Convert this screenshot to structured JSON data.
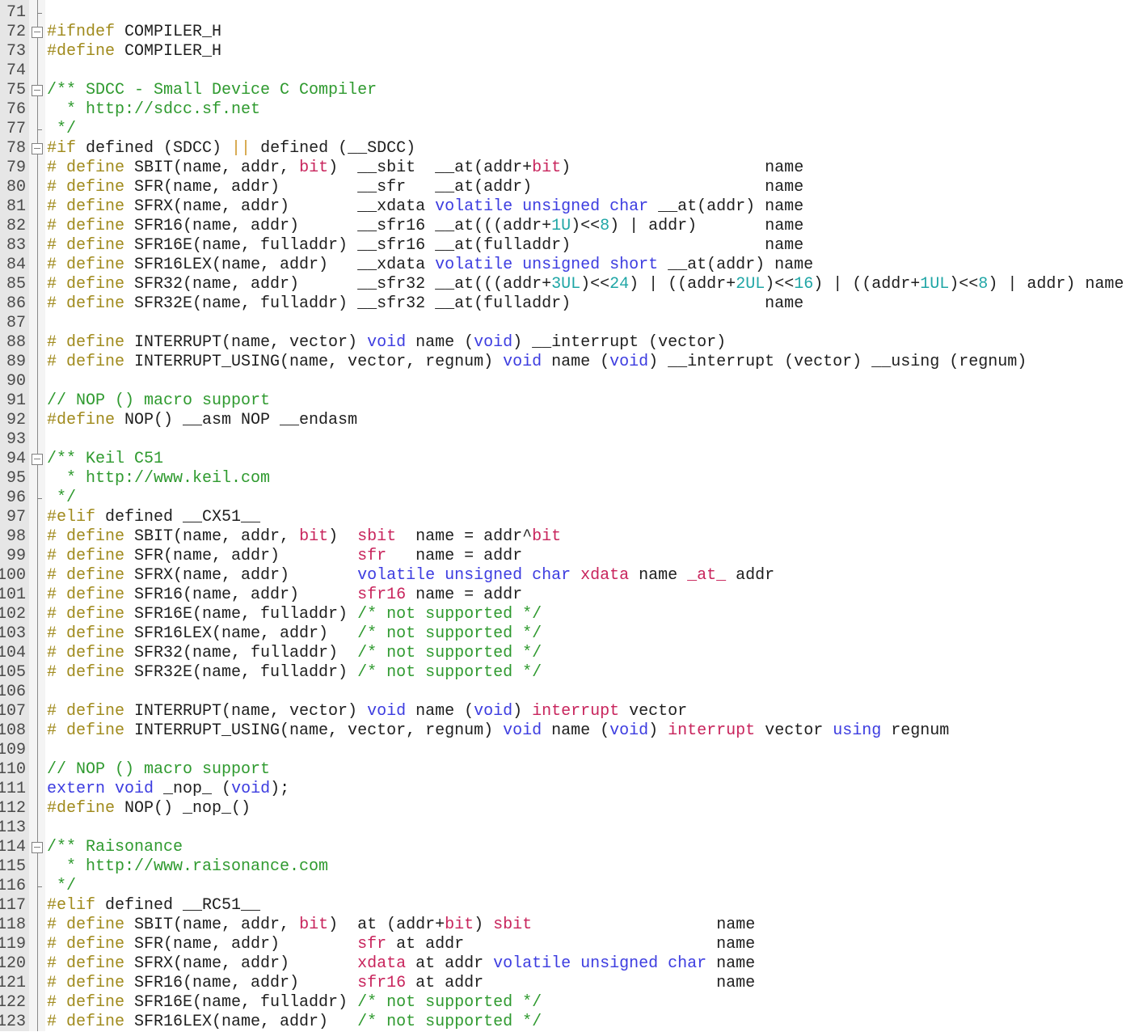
{
  "editor": {
    "colors": {
      "preprocessor": "#a08a1c",
      "comment": "#2f9a2f",
      "keyword": "#3c3ce0",
      "keyword2": "#c8245c",
      "number": "#20a6a6",
      "operator": "#d09a30",
      "text": "#1e1e1e"
    },
    "lines": [
      {
        "n": "71",
        "fold": "end",
        "tok": []
      },
      {
        "n": "72",
        "fold": "open",
        "tok": [
          [
            "pp",
            "#ifndef"
          ],
          [
            "p",
            " COMPILER_H"
          ]
        ]
      },
      {
        "n": "73",
        "fold": "",
        "tok": [
          [
            "pp",
            "#define"
          ],
          [
            "p",
            " COMPILER_H"
          ]
        ]
      },
      {
        "n": "74",
        "fold": "",
        "tok": []
      },
      {
        "n": "75",
        "fold": "open",
        "tok": [
          [
            "c",
            "/** SDCC - Small Device C Compiler"
          ]
        ]
      },
      {
        "n": "76",
        "fold": "",
        "tok": [
          [
            "c",
            "  * http://sdcc.sf.net"
          ]
        ]
      },
      {
        "n": "77",
        "fold": "end",
        "tok": [
          [
            "c",
            " */"
          ]
        ]
      },
      {
        "n": "78",
        "fold": "open",
        "tok": [
          [
            "pp",
            "#if"
          ],
          [
            "p",
            " defined (SDCC) "
          ],
          [
            "o",
            "||"
          ],
          [
            "p",
            " defined (__SDCC)"
          ]
        ]
      },
      {
        "n": "79",
        "fold": "",
        "tok": [
          [
            "pp",
            "# define"
          ],
          [
            "p",
            " SBIT(name, addr, "
          ],
          [
            "r",
            "bit"
          ],
          [
            "p",
            ")  __sbit  __at(addr+"
          ],
          [
            "r",
            "bit"
          ],
          [
            "p",
            ")                    name"
          ]
        ]
      },
      {
        "n": "80",
        "fold": "",
        "tok": [
          [
            "pp",
            "# define"
          ],
          [
            "p",
            " SFR(name, addr)        __sfr   __at(addr)                        name"
          ]
        ]
      },
      {
        "n": "81",
        "fold": "",
        "tok": [
          [
            "pp",
            "# define"
          ],
          [
            "p",
            " SFRX(name, addr)       __xdata "
          ],
          [
            "b",
            "volatile unsigned char"
          ],
          [
            "p",
            " __at(addr) name"
          ]
        ]
      },
      {
        "n": "82",
        "fold": "",
        "tok": [
          [
            "pp",
            "# define"
          ],
          [
            "p",
            " SFR16(name, addr)      __sfr16 __at(((addr+"
          ],
          [
            "n",
            "1U"
          ],
          [
            "p",
            ")<<"
          ],
          [
            "n",
            "8"
          ],
          [
            "p",
            ") | addr)       name"
          ]
        ]
      },
      {
        "n": "83",
        "fold": "",
        "tok": [
          [
            "pp",
            "# define"
          ],
          [
            "p",
            " SFR16E(name, fulladdr) __sfr16 __at(fulladdr)                    name"
          ]
        ]
      },
      {
        "n": "84",
        "fold": "",
        "tok": [
          [
            "pp",
            "# define"
          ],
          [
            "p",
            " SFR16LEX(name, addr)   __xdata "
          ],
          [
            "b",
            "volatile unsigned short"
          ],
          [
            "p",
            " __at(addr) name"
          ]
        ]
      },
      {
        "n": "85",
        "fold": "",
        "tok": [
          [
            "pp",
            "# define"
          ],
          [
            "p",
            " SFR32(name, addr)      __sfr32 __at(((addr+"
          ],
          [
            "n",
            "3UL"
          ],
          [
            "p",
            ")<<"
          ],
          [
            "n",
            "24"
          ],
          [
            "p",
            ") | ((addr+"
          ],
          [
            "n",
            "2UL"
          ],
          [
            "p",
            ")<<"
          ],
          [
            "n",
            "16"
          ],
          [
            "p",
            ") | ((addr+"
          ],
          [
            "n",
            "1UL"
          ],
          [
            "p",
            ")<<"
          ],
          [
            "n",
            "8"
          ],
          [
            "p",
            ") | addr) name"
          ]
        ]
      },
      {
        "n": "86",
        "fold": "",
        "tok": [
          [
            "pp",
            "# define"
          ],
          [
            "p",
            " SFR32E(name, fulladdr) __sfr32 __at(fulladdr)                    name"
          ]
        ]
      },
      {
        "n": "87",
        "fold": "",
        "tok": []
      },
      {
        "n": "88",
        "fold": "",
        "tok": [
          [
            "pp",
            "# define"
          ],
          [
            "p",
            " INTERRUPT(name, vector) "
          ],
          [
            "b",
            "void"
          ],
          [
            "p",
            " name ("
          ],
          [
            "b",
            "void"
          ],
          [
            "p",
            ") __interrupt (vector)"
          ]
        ]
      },
      {
        "n": "89",
        "fold": "",
        "tok": [
          [
            "pp",
            "# define"
          ],
          [
            "p",
            " INTERRUPT_USING(name, vector, regnum) "
          ],
          [
            "b",
            "void"
          ],
          [
            "p",
            " name ("
          ],
          [
            "b",
            "void"
          ],
          [
            "p",
            ") __interrupt (vector) __using (regnum)"
          ]
        ]
      },
      {
        "n": "90",
        "fold": "",
        "tok": []
      },
      {
        "n": "91",
        "fold": "",
        "tok": [
          [
            "c",
            "// NOP () macro support"
          ]
        ]
      },
      {
        "n": "92",
        "fold": "",
        "tok": [
          [
            "pp",
            "#define"
          ],
          [
            "p",
            " NOP() __asm NOP __endasm"
          ]
        ]
      },
      {
        "n": "93",
        "fold": "",
        "tok": []
      },
      {
        "n": "94",
        "fold": "open",
        "tok": [
          [
            "c",
            "/** Keil C51"
          ]
        ]
      },
      {
        "n": "95",
        "fold": "",
        "tok": [
          [
            "c",
            "  * http://www.keil.com"
          ]
        ]
      },
      {
        "n": "96",
        "fold": "end",
        "tok": [
          [
            "c",
            " */"
          ]
        ]
      },
      {
        "n": "97",
        "fold": "",
        "tok": [
          [
            "pp",
            "#elif"
          ],
          [
            "p",
            " defined __CX51__"
          ]
        ]
      },
      {
        "n": "98",
        "fold": "",
        "tok": [
          [
            "pp",
            "# define"
          ],
          [
            "p",
            " SBIT(name, addr, "
          ],
          [
            "r",
            "bit"
          ],
          [
            "p",
            ")  "
          ],
          [
            "r",
            "sbit"
          ],
          [
            "p",
            "  name = addr^"
          ],
          [
            "r",
            "bit"
          ]
        ]
      },
      {
        "n": "99",
        "fold": "",
        "tok": [
          [
            "pp",
            "# define"
          ],
          [
            "p",
            " SFR(name, addr)        "
          ],
          [
            "r",
            "sfr"
          ],
          [
            "p",
            "   name = addr"
          ]
        ]
      },
      {
        "n": "100",
        "fold": "",
        "tok": [
          [
            "pp",
            "# define"
          ],
          [
            "p",
            " SFRX(name, addr)       "
          ],
          [
            "b",
            "volatile unsigned char"
          ],
          [
            "p",
            " "
          ],
          [
            "r",
            "xdata"
          ],
          [
            "p",
            " name "
          ],
          [
            "r",
            "_at_"
          ],
          [
            "p",
            " addr"
          ]
        ]
      },
      {
        "n": "101",
        "fold": "",
        "tok": [
          [
            "pp",
            "# define"
          ],
          [
            "p",
            " SFR16(name, addr)      "
          ],
          [
            "r",
            "sfr16"
          ],
          [
            "p",
            " name = addr"
          ]
        ]
      },
      {
        "n": "102",
        "fold": "",
        "tok": [
          [
            "pp",
            "# define"
          ],
          [
            "p",
            " SFR16E(name, fulladdr) "
          ],
          [
            "c",
            "/* not supported */"
          ]
        ]
      },
      {
        "n": "103",
        "fold": "",
        "tok": [
          [
            "pp",
            "# define"
          ],
          [
            "p",
            " SFR16LEX(name, addr)   "
          ],
          [
            "c",
            "/* not supported */"
          ]
        ]
      },
      {
        "n": "104",
        "fold": "",
        "tok": [
          [
            "pp",
            "# define"
          ],
          [
            "p",
            " SFR32(name, fulladdr)  "
          ],
          [
            "c",
            "/* not supported */"
          ]
        ]
      },
      {
        "n": "105",
        "fold": "",
        "tok": [
          [
            "pp",
            "# define"
          ],
          [
            "p",
            " SFR32E(name, fulladdr) "
          ],
          [
            "c",
            "/* not supported */"
          ]
        ]
      },
      {
        "n": "106",
        "fold": "",
        "tok": []
      },
      {
        "n": "107",
        "fold": "",
        "tok": [
          [
            "pp",
            "# define"
          ],
          [
            "p",
            " INTERRUPT(name, vector) "
          ],
          [
            "b",
            "void"
          ],
          [
            "p",
            " name ("
          ],
          [
            "b",
            "void"
          ],
          [
            "p",
            ") "
          ],
          [
            "r",
            "interrupt"
          ],
          [
            "p",
            " vector"
          ]
        ]
      },
      {
        "n": "108",
        "fold": "",
        "tok": [
          [
            "pp",
            "# define"
          ],
          [
            "p",
            " INTERRUPT_USING(name, vector, regnum) "
          ],
          [
            "b",
            "void"
          ],
          [
            "p",
            " name ("
          ],
          [
            "b",
            "void"
          ],
          [
            "p",
            ") "
          ],
          [
            "r",
            "interrupt"
          ],
          [
            "p",
            " vector "
          ],
          [
            "b",
            "using"
          ],
          [
            "p",
            " regnum"
          ]
        ]
      },
      {
        "n": "109",
        "fold": "",
        "tok": []
      },
      {
        "n": "110",
        "fold": "",
        "tok": [
          [
            "c",
            "// NOP () macro support"
          ]
        ]
      },
      {
        "n": "111",
        "fold": "",
        "tok": [
          [
            "b",
            "extern"
          ],
          [
            "p",
            " "
          ],
          [
            "b",
            "void"
          ],
          [
            "p",
            " _nop_ ("
          ],
          [
            "b",
            "void"
          ],
          [
            "p",
            ");"
          ]
        ]
      },
      {
        "n": "112",
        "fold": "",
        "tok": [
          [
            "pp",
            "#define"
          ],
          [
            "p",
            " NOP() _nop_()"
          ]
        ]
      },
      {
        "n": "113",
        "fold": "",
        "tok": []
      },
      {
        "n": "114",
        "fold": "open",
        "tok": [
          [
            "c",
            "/** Raisonance"
          ]
        ]
      },
      {
        "n": "115",
        "fold": "",
        "tok": [
          [
            "c",
            "  * http://www.raisonance.com"
          ]
        ]
      },
      {
        "n": "116",
        "fold": "end",
        "tok": [
          [
            "c",
            " */"
          ]
        ]
      },
      {
        "n": "117",
        "fold": "",
        "tok": [
          [
            "pp",
            "#elif"
          ],
          [
            "p",
            " defined __RC51__"
          ]
        ]
      },
      {
        "n": "118",
        "fold": "",
        "tok": [
          [
            "pp",
            "# define"
          ],
          [
            "p",
            " SBIT(name, addr, "
          ],
          [
            "r",
            "bit"
          ],
          [
            "p",
            ")  at (addr+"
          ],
          [
            "r",
            "bit"
          ],
          [
            "p",
            ") "
          ],
          [
            "r",
            "sbit"
          ],
          [
            "p",
            "                   name"
          ]
        ]
      },
      {
        "n": "119",
        "fold": "",
        "tok": [
          [
            "pp",
            "# define"
          ],
          [
            "p",
            " SFR(name, addr)        "
          ],
          [
            "r",
            "sfr"
          ],
          [
            "p",
            " at addr                          name"
          ]
        ]
      },
      {
        "n": "120",
        "fold": "",
        "tok": [
          [
            "pp",
            "# define"
          ],
          [
            "p",
            " SFRX(name, addr)       "
          ],
          [
            "r",
            "xdata"
          ],
          [
            "p",
            " at addr "
          ],
          [
            "b",
            "volatile unsigned char"
          ],
          [
            "p",
            " name"
          ]
        ]
      },
      {
        "n": "121",
        "fold": "",
        "tok": [
          [
            "pp",
            "# define"
          ],
          [
            "p",
            " SFR16(name, addr)      "
          ],
          [
            "r",
            "sfr16"
          ],
          [
            "p",
            " at addr                        name"
          ]
        ]
      },
      {
        "n": "122",
        "fold": "",
        "tok": [
          [
            "pp",
            "# define"
          ],
          [
            "p",
            " SFR16E(name, fulladdr) "
          ],
          [
            "c",
            "/* not supported */"
          ]
        ]
      },
      {
        "n": "123",
        "fold": "",
        "tok": [
          [
            "pp",
            "# define"
          ],
          [
            "p",
            " SFR16LEX(name, addr)   "
          ],
          [
            "c",
            "/* not supported */"
          ]
        ]
      }
    ]
  }
}
